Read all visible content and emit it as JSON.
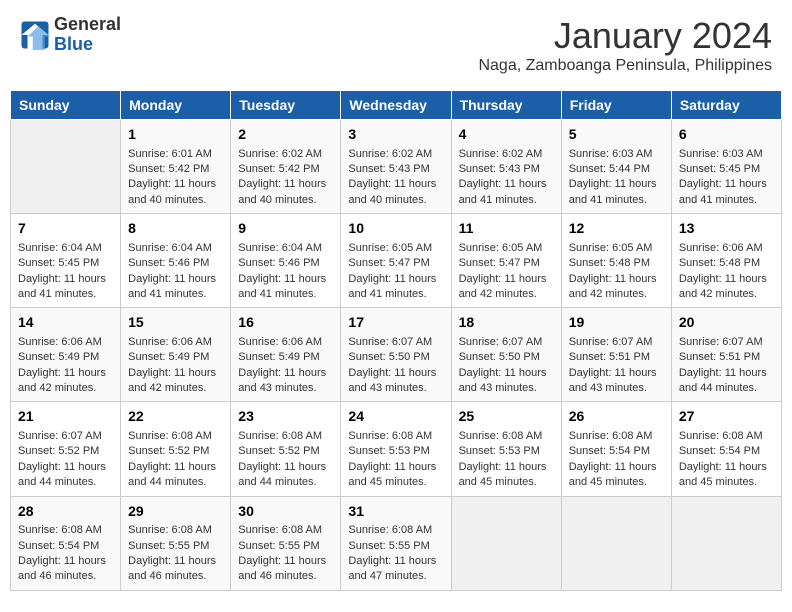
{
  "header": {
    "logo_line1": "General",
    "logo_line2": "Blue",
    "month": "January 2024",
    "location": "Naga, Zamboanga Peninsula, Philippines"
  },
  "days_of_week": [
    "Sunday",
    "Monday",
    "Tuesday",
    "Wednesday",
    "Thursday",
    "Friday",
    "Saturday"
  ],
  "weeks": [
    [
      {
        "day": "",
        "empty": true
      },
      {
        "day": "1",
        "sunrise": "6:01 AM",
        "sunset": "5:42 PM",
        "daylight": "11 hours and 40 minutes."
      },
      {
        "day": "2",
        "sunrise": "6:02 AM",
        "sunset": "5:42 PM",
        "daylight": "11 hours and 40 minutes."
      },
      {
        "day": "3",
        "sunrise": "6:02 AM",
        "sunset": "5:43 PM",
        "daylight": "11 hours and 40 minutes."
      },
      {
        "day": "4",
        "sunrise": "6:02 AM",
        "sunset": "5:43 PM",
        "daylight": "11 hours and 41 minutes."
      },
      {
        "day": "5",
        "sunrise": "6:03 AM",
        "sunset": "5:44 PM",
        "daylight": "11 hours and 41 minutes."
      },
      {
        "day": "6",
        "sunrise": "6:03 AM",
        "sunset": "5:45 PM",
        "daylight": "11 hours and 41 minutes."
      }
    ],
    [
      {
        "day": "7",
        "sunrise": "6:04 AM",
        "sunset": "5:45 PM",
        "daylight": "11 hours and 41 minutes."
      },
      {
        "day": "8",
        "sunrise": "6:04 AM",
        "sunset": "5:46 PM",
        "daylight": "11 hours and 41 minutes."
      },
      {
        "day": "9",
        "sunrise": "6:04 AM",
        "sunset": "5:46 PM",
        "daylight": "11 hours and 41 minutes."
      },
      {
        "day": "10",
        "sunrise": "6:05 AM",
        "sunset": "5:47 PM",
        "daylight": "11 hours and 41 minutes."
      },
      {
        "day": "11",
        "sunrise": "6:05 AM",
        "sunset": "5:47 PM",
        "daylight": "11 hours and 42 minutes."
      },
      {
        "day": "12",
        "sunrise": "6:05 AM",
        "sunset": "5:48 PM",
        "daylight": "11 hours and 42 minutes."
      },
      {
        "day": "13",
        "sunrise": "6:06 AM",
        "sunset": "5:48 PM",
        "daylight": "11 hours and 42 minutes."
      }
    ],
    [
      {
        "day": "14",
        "sunrise": "6:06 AM",
        "sunset": "5:49 PM",
        "daylight": "11 hours and 42 minutes."
      },
      {
        "day": "15",
        "sunrise": "6:06 AM",
        "sunset": "5:49 PM",
        "daylight": "11 hours and 42 minutes."
      },
      {
        "day": "16",
        "sunrise": "6:06 AM",
        "sunset": "5:49 PM",
        "daylight": "11 hours and 43 minutes."
      },
      {
        "day": "17",
        "sunrise": "6:07 AM",
        "sunset": "5:50 PM",
        "daylight": "11 hours and 43 minutes."
      },
      {
        "day": "18",
        "sunrise": "6:07 AM",
        "sunset": "5:50 PM",
        "daylight": "11 hours and 43 minutes."
      },
      {
        "day": "19",
        "sunrise": "6:07 AM",
        "sunset": "5:51 PM",
        "daylight": "11 hours and 43 minutes."
      },
      {
        "day": "20",
        "sunrise": "6:07 AM",
        "sunset": "5:51 PM",
        "daylight": "11 hours and 44 minutes."
      }
    ],
    [
      {
        "day": "21",
        "sunrise": "6:07 AM",
        "sunset": "5:52 PM",
        "daylight": "11 hours and 44 minutes."
      },
      {
        "day": "22",
        "sunrise": "6:08 AM",
        "sunset": "5:52 PM",
        "daylight": "11 hours and 44 minutes."
      },
      {
        "day": "23",
        "sunrise": "6:08 AM",
        "sunset": "5:52 PM",
        "daylight": "11 hours and 44 minutes."
      },
      {
        "day": "24",
        "sunrise": "6:08 AM",
        "sunset": "5:53 PM",
        "daylight": "11 hours and 45 minutes."
      },
      {
        "day": "25",
        "sunrise": "6:08 AM",
        "sunset": "5:53 PM",
        "daylight": "11 hours and 45 minutes."
      },
      {
        "day": "26",
        "sunrise": "6:08 AM",
        "sunset": "5:54 PM",
        "daylight": "11 hours and 45 minutes."
      },
      {
        "day": "27",
        "sunrise": "6:08 AM",
        "sunset": "5:54 PM",
        "daylight": "11 hours and 45 minutes."
      }
    ],
    [
      {
        "day": "28",
        "sunrise": "6:08 AM",
        "sunset": "5:54 PM",
        "daylight": "11 hours and 46 minutes."
      },
      {
        "day": "29",
        "sunrise": "6:08 AM",
        "sunset": "5:55 PM",
        "daylight": "11 hours and 46 minutes."
      },
      {
        "day": "30",
        "sunrise": "6:08 AM",
        "sunset": "5:55 PM",
        "daylight": "11 hours and 46 minutes."
      },
      {
        "day": "31",
        "sunrise": "6:08 AM",
        "sunset": "5:55 PM",
        "daylight": "11 hours and 47 minutes."
      },
      {
        "day": "",
        "empty": true
      },
      {
        "day": "",
        "empty": true
      },
      {
        "day": "",
        "empty": true
      }
    ]
  ],
  "labels": {
    "sunrise": "Sunrise: ",
    "sunset": "Sunset: ",
    "daylight": "Daylight: "
  }
}
